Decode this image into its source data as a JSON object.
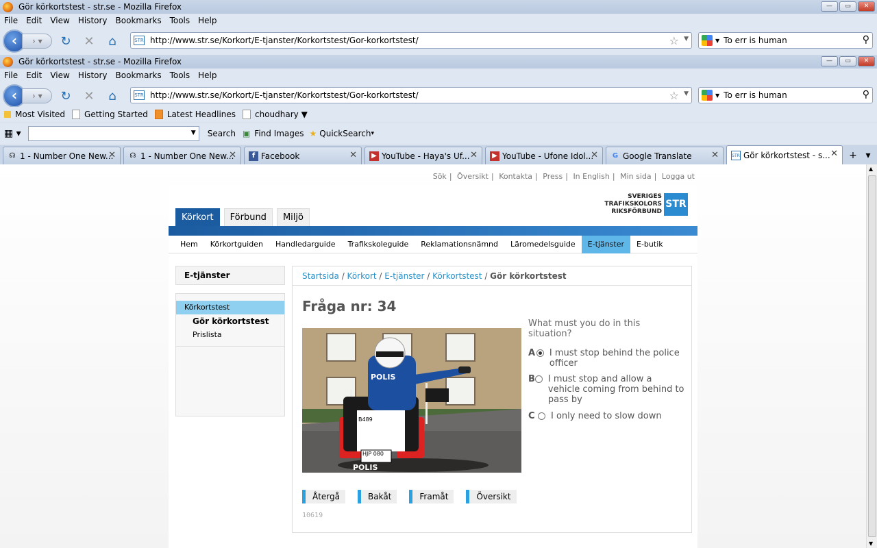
{
  "window": {
    "title": "Gör körkortstest - str.se - Mozilla Firefox",
    "buttons": {
      "min": "—",
      "max": "▭",
      "close": "✕"
    }
  },
  "menu": [
    "File",
    "Edit",
    "View",
    "History",
    "Bookmarks",
    "Tools",
    "Help"
  ],
  "address": {
    "url": "http://www.str.se/Korkort/E-tjanster/Korkortstest/Gor-korkortstest/",
    "favicon": "STR"
  },
  "search": {
    "value": "To err is human"
  },
  "bookmarks": [
    {
      "label": "Most Visited"
    },
    {
      "label": "Getting Started"
    },
    {
      "label": "Latest Headlines"
    },
    {
      "label": "choudhary ▼"
    }
  ],
  "toolbar2": {
    "search": "Search",
    "find_images": "Find Images",
    "quicksearch": "QuickSearch"
  },
  "tabs": [
    {
      "label": "1 - Number One New...",
      "icon": "☊"
    },
    {
      "label": "1 - Number One New...",
      "icon": "☊"
    },
    {
      "label": "Facebook",
      "icon": "f"
    },
    {
      "label": "YouTube - Haya's Uf...",
      "icon": "▶"
    },
    {
      "label": "YouTube - Ufone Idol...",
      "icon": "▶"
    },
    {
      "label": "Google Translate",
      "icon": "G"
    },
    {
      "label": "Gör körkortstest - s...",
      "icon": "STR",
      "active": true
    }
  ],
  "site": {
    "toplinks": [
      "Sök",
      "|",
      "Översikt",
      "|",
      "Kontakta",
      "|",
      "Press",
      "|",
      "In English",
      "|",
      "Min sida",
      "|",
      "Logga ut"
    ],
    "main_tabs": [
      "Körkort",
      "Förbund",
      "Miljö"
    ],
    "logo": {
      "line1": "SVERIGES",
      "line2": "TRAFIKSKOLORS",
      "line3": "RIKSFÖRBUND",
      "mark": "STR"
    },
    "subnav": [
      "Hem",
      "Körkortguiden",
      "Handledarguide",
      "Trafikskoleguide",
      "Reklamationsnämnd",
      "Läromedelsguide",
      "E-tjänster",
      "E-butik"
    ],
    "sidebar": {
      "heading": "E-tjänster",
      "items": [
        "Körkortstest",
        "Gör körkortstest",
        "Prislista"
      ]
    },
    "breadcrumb": [
      "Startsida",
      "Körkort",
      "E-tjänster",
      "Körkortstest",
      "Gör körkortstest"
    ],
    "question": {
      "title": "Fråga nr: 34",
      "text": "What must you do in this situation?",
      "options": [
        {
          "letter": "A",
          "text": "I must stop behind the police officer",
          "selected": true
        },
        {
          "letter": "B",
          "text": "I must stop and allow a vehicle coming from behind to pass by",
          "selected": false
        },
        {
          "letter": "C",
          "text": "I only need to slow down",
          "selected": false
        }
      ]
    },
    "photo": {
      "label": "POLIS",
      "plate": "HJP 080",
      "number": "B489"
    },
    "buttons": [
      "Återgå",
      "Bakåt",
      "Framåt",
      "Översikt"
    ],
    "code": "10619"
  }
}
